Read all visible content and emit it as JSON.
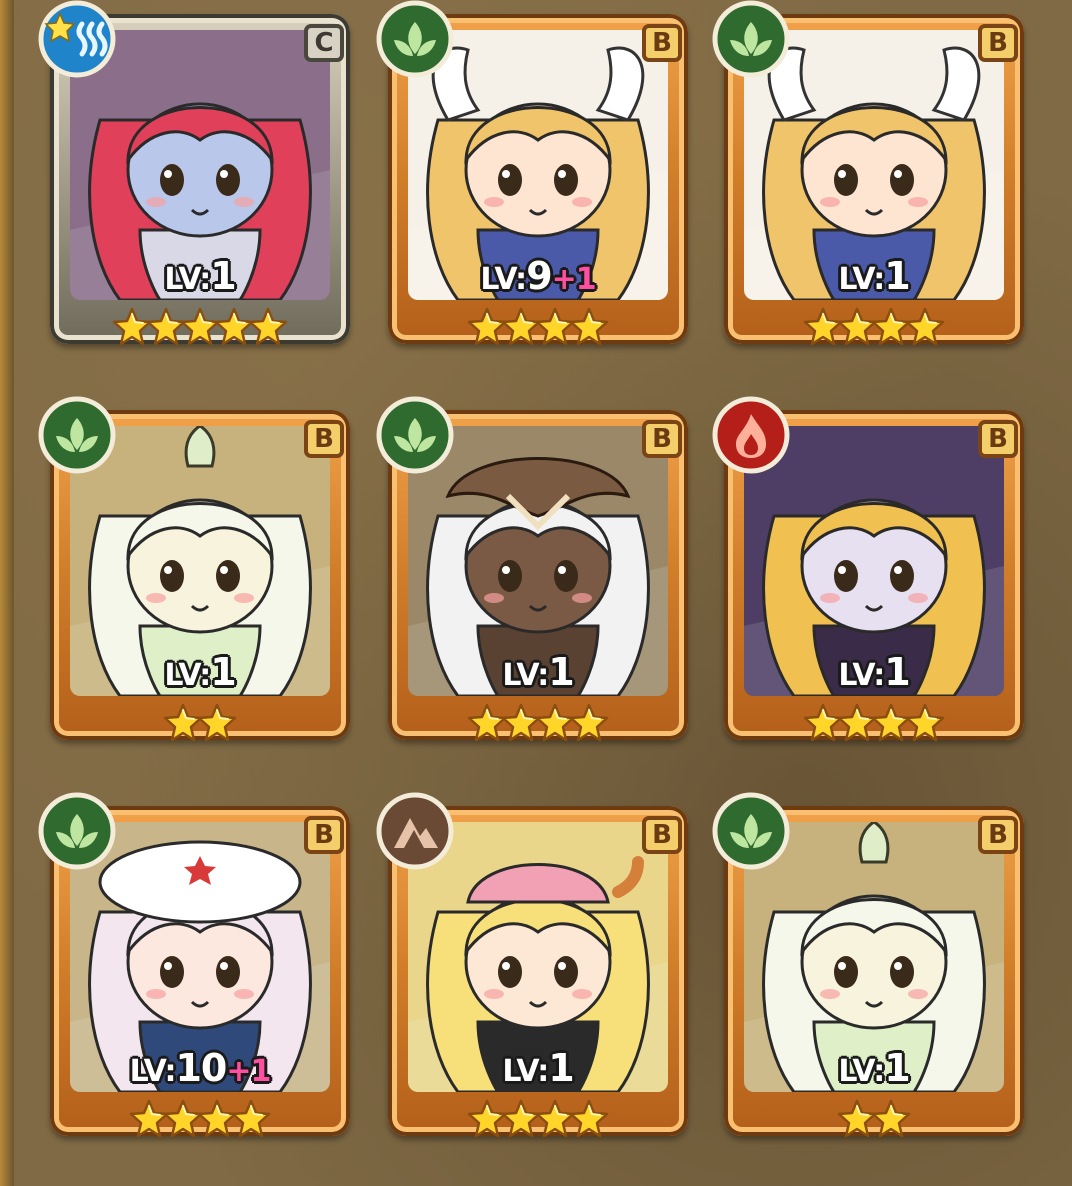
{
  "colors": {
    "grass": "#2f6b2f",
    "fire": "#b51f1a",
    "water": "#1f84c9",
    "earth": "#6b4a35",
    "star": "#ffd52a",
    "plus": "#ff4fa0"
  },
  "cards": [
    {
      "element": "water",
      "element_icon": "water-star-icon",
      "rank": "C",
      "lv_label": "LV:",
      "level": "1",
      "bonus": "",
      "stars": 5,
      "hair": "#e0405a",
      "skin": "#b9c8ea",
      "bg": "#8a6e8a",
      "outfit": "#d8d8e6",
      "hat": ""
    },
    {
      "element": "grass",
      "element_icon": "leaf-icon",
      "rank": "B",
      "lv_label": "LV:",
      "level": "9",
      "bonus": "+1",
      "stars": 4,
      "hair": "#f0c46a",
      "skin": "#fde5d2",
      "bg": "#f6f1e8",
      "outfit": "#4a5aa8",
      "hat": "wings"
    },
    {
      "element": "grass",
      "element_icon": "leaf-icon",
      "rank": "B",
      "lv_label": "LV:",
      "level": "1",
      "bonus": "",
      "stars": 4,
      "hair": "#f0c46a",
      "skin": "#fde5d2",
      "bg": "#f6f1e8",
      "outfit": "#4a5aa8",
      "hat": "wings"
    },
    {
      "element": "grass",
      "element_icon": "leaf-icon",
      "rank": "B",
      "lv_label": "LV:",
      "level": "1",
      "bonus": "",
      "stars": 2,
      "hair": "#f4f7ea",
      "skin": "#f7f3dc",
      "bg": "#c7b27d",
      "outfit": "#dff0c8",
      "hat": "sprout"
    },
    {
      "element": "grass",
      "element_icon": "leaf-icon",
      "rank": "B",
      "lv_label": "LV:",
      "level": "1",
      "bonus": "",
      "stars": 4,
      "hair": "#f2f2f2",
      "skin": "#7a5a44",
      "bg": "#9a8868",
      "outfit": "#5a4232",
      "hat": "owl"
    },
    {
      "element": "fire",
      "element_icon": "flame-icon",
      "rank": "B",
      "lv_label": "LV:",
      "level": "1",
      "bonus": "",
      "stars": 4,
      "hair": "#f0c050",
      "skin": "#e6e0f0",
      "bg": "#4e3e66",
      "outfit": "#3a2c48",
      "hat": ""
    },
    {
      "element": "grass",
      "element_icon": "leaf-icon",
      "rank": "B",
      "lv_label": "LV:",
      "level": "10",
      "bonus": "+1",
      "stars": 4,
      "hair": "#f4e6ee",
      "skin": "#fde8e0",
      "bg": "#c8b68a",
      "outfit": "#2f4a7a",
      "hat": "beret"
    },
    {
      "element": "earth",
      "element_icon": "mountain-icon",
      "rank": "B",
      "lv_label": "LV:",
      "level": "1",
      "bonus": "",
      "stars": 4,
      "hair": "#f7e07a",
      "skin": "#fde8d6",
      "bg": "#e9d68a",
      "outfit": "#2a2a2a",
      "hat": "pink"
    },
    {
      "element": "grass",
      "element_icon": "leaf-icon",
      "rank": "B",
      "lv_label": "LV:",
      "level": "1",
      "bonus": "",
      "stars": 2,
      "hair": "#f4f7ea",
      "skin": "#f7f3dc",
      "bg": "#c7b27d",
      "outfit": "#dff0c8",
      "hat": "sprout"
    }
  ]
}
